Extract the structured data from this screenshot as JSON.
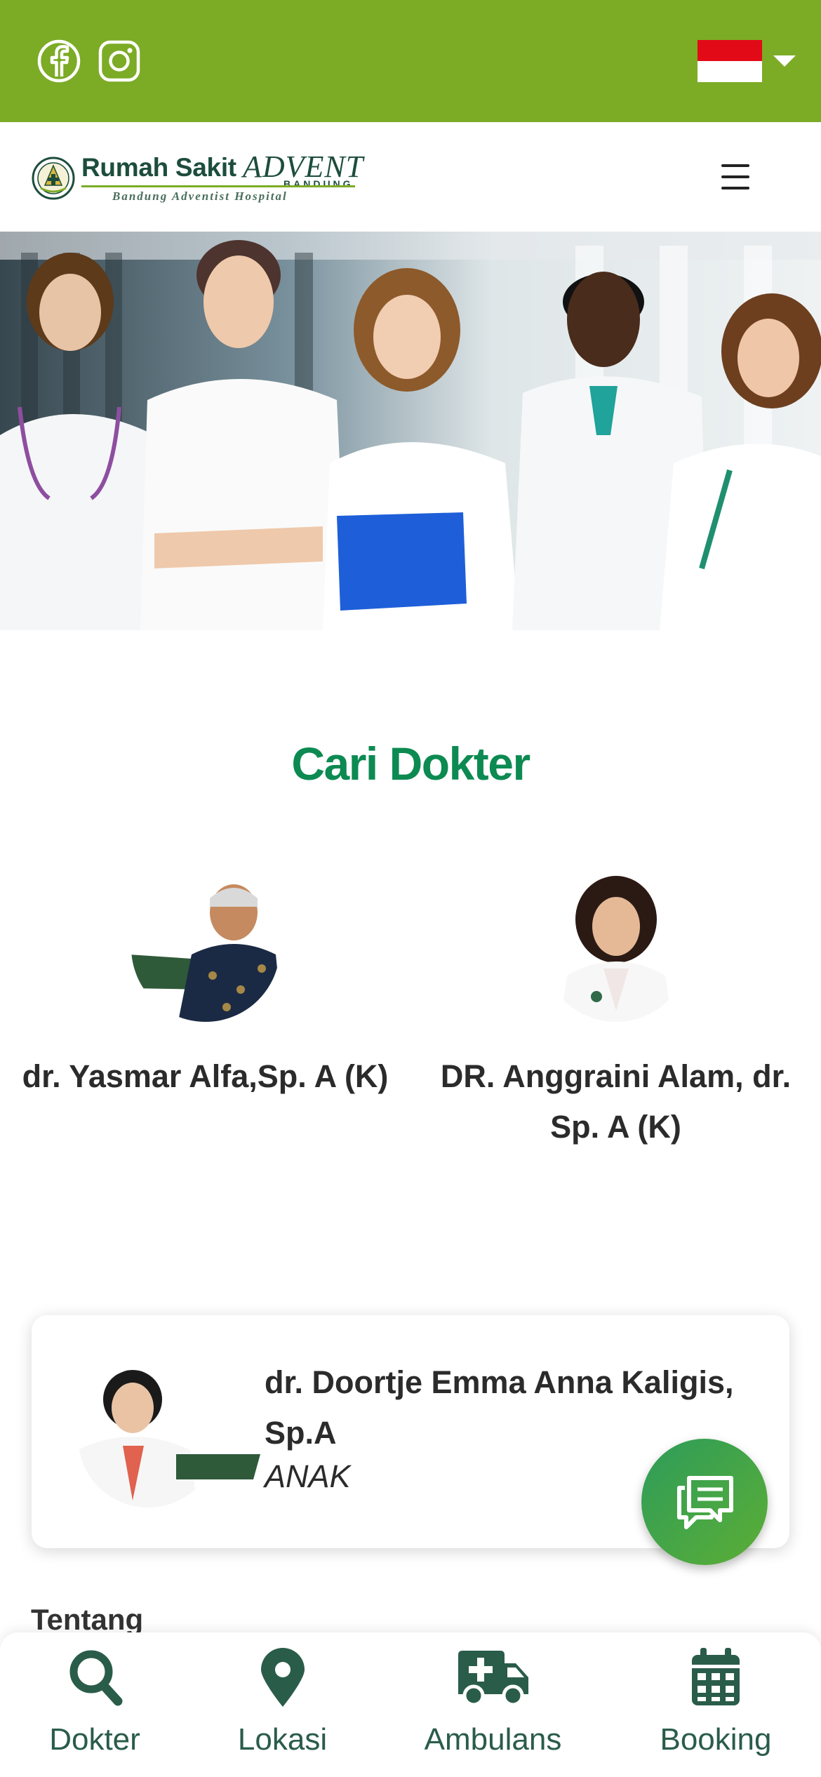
{
  "topbar": {
    "social": [
      {
        "name": "Facebook",
        "icon": "facebook-icon"
      },
      {
        "name": "Instagram",
        "icon": "instagram-icon"
      }
    ],
    "language": {
      "flag": "indonesia-flag-icon",
      "icon": "caret-down-icon"
    }
  },
  "header": {
    "logo": {
      "title": "Rumah Sakit",
      "brand": "ADVENT",
      "city": "BANDUNG",
      "tagline": "Bandung Adventist Hospital"
    },
    "menu_icon": "hamburger-menu-icon"
  },
  "section": {
    "title": "Cari Dokter"
  },
  "doctors": [
    {
      "name": "dr. Yasmar Alfa,Sp. A (K)"
    },
    {
      "name": "DR. Anggraini Alam, dr. Sp. A (K)"
    }
  ],
  "featured_doctor": {
    "name": "dr. Doortje Emma Anna Kaligis, Sp.A",
    "specialty": "ANAK"
  },
  "chat": {
    "icon": "chat-bubbles-icon"
  },
  "about": {
    "heading": "Tentang"
  },
  "bottom_nav": {
    "items": [
      {
        "label": "Dokter",
        "icon": "search-icon"
      },
      {
        "label": "Lokasi",
        "icon": "location-pin-icon"
      },
      {
        "label": "Ambulans",
        "icon": "ambulance-icon"
      },
      {
        "label": "Booking",
        "icon": "calendar-icon"
      }
    ]
  },
  "colors": {
    "topbar": "#7cab26",
    "title_green": "#0c8a52",
    "nav_green": "#2a5c4a",
    "logo_green": "#1d4d3c"
  }
}
